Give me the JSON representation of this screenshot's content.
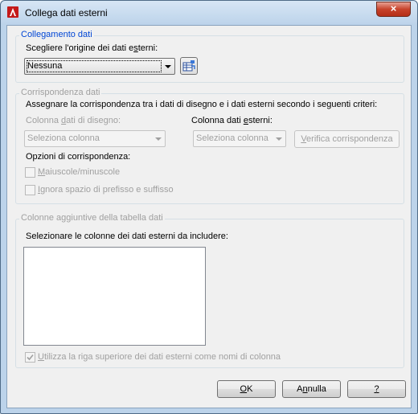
{
  "window": {
    "title": "Collega dati esterni",
    "close_label": "×"
  },
  "link_group": {
    "legend": "Collegamento dati",
    "source_label_pre": "Scegliere l'origine dei dati e",
    "source_label_ul": "s",
    "source_label_post": "terni:",
    "source_value": "Nessuna"
  },
  "match_group": {
    "legend": "Corrispondenza dati",
    "instructions": "Assegnare la corrispondenza tra i dati di disegno e i dati esterni secondo i seguenti criteri:",
    "drawing_col_label_pre": "Colonna ",
    "drawing_col_label_ul": "d",
    "drawing_col_label_post": "ati di disegno:",
    "drawing_col_value": "Seleziona colonna",
    "external_col_label_pre": "Colonna dati ",
    "external_col_label_ul": "e",
    "external_col_label_post": "sterni:",
    "external_col_value": "Seleziona colonna",
    "verify_label_ul": "V",
    "verify_label_post": "erifica corrispondenza",
    "options_label": "Opzioni di corrispondenza:",
    "case_label_ul": "M",
    "case_label_post": "aiuscole/minuscole",
    "space_label_ul": "I",
    "space_label_post": "gnora spazio di prefisso e suffisso"
  },
  "extra_group": {
    "legend": "Colonne aggiuntive della tabella dati",
    "select_label": "Selezionare le colonne dei dati esterni da includere:",
    "header_row_label_ul": "U",
    "header_row_label_post": "tilizza la riga superiore dei dati esterni come nomi di colonna"
  },
  "buttons": {
    "ok_ul": "O",
    "ok_post": "K",
    "cancel_pre": "A",
    "cancel_ul": "n",
    "cancel_post": "nulla",
    "help_ul": "?"
  }
}
